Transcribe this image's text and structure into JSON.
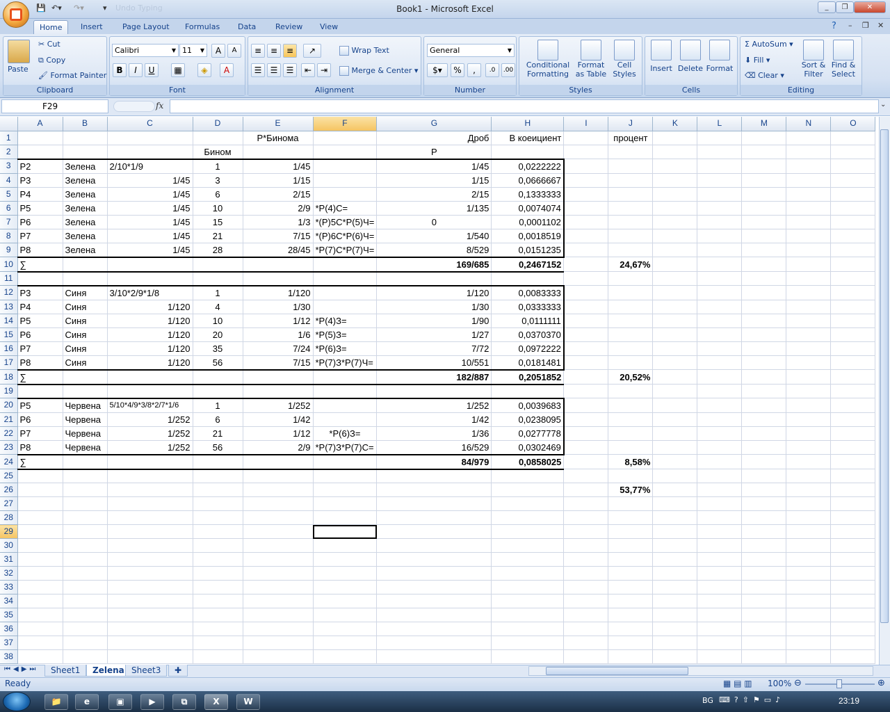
{
  "window": {
    "title": "Book1 - Microsoft Excel",
    "qat_hint": "Undo Typing"
  },
  "tabs": [
    "Home",
    "Insert",
    "Page Layout",
    "Formulas",
    "Data",
    "Review",
    "View"
  ],
  "ribbon": {
    "clipboard": {
      "paste": "Paste",
      "cut": "Cut",
      "copy": "Copy",
      "format_painter": "Format Painter",
      "label": "Clipboard"
    },
    "font": {
      "name": "Calibri",
      "size": "11",
      "bold": "B",
      "italic": "I",
      "underline": "U",
      "label": "Font"
    },
    "alignment": {
      "wrap": "Wrap Text",
      "merge": "Merge & Center",
      "label": "Alignment"
    },
    "number": {
      "format": "General",
      "percent": "%",
      "comma": ",",
      "label": "Number"
    },
    "styles": {
      "cond1": "Conditional",
      "cond2": "Formatting",
      "fat1": "Format",
      "fat2": "as Table",
      "cs1": "Cell",
      "cs2": "Styles",
      "label": "Styles"
    },
    "cells": {
      "insert": "Insert",
      "delete": "Delete",
      "format": "Format",
      "label": "Cells"
    },
    "editing": {
      "autosum": "AutoSum",
      "fill": "Fill",
      "clear": "Clear",
      "sort1": "Sort &",
      "sort2": "Filter",
      "find1": "Find &",
      "find2": "Select",
      "label": "Editing"
    }
  },
  "formula_bar": {
    "name_box": "F29",
    "fx": "fx",
    "value": ""
  },
  "columns": [
    "A",
    "B",
    "C",
    "D",
    "E",
    "F",
    "G",
    "H",
    "I",
    "J",
    "K",
    "L",
    "M",
    "N",
    "O"
  ],
  "rows": [
    {
      "n": "1",
      "A": "",
      "B": "",
      "C": "",
      "D": "",
      "E": "P*Бинома",
      "F": "",
      "G": "Дроб",
      "H": "В коеициент",
      "I": "",
      "J": "процент"
    },
    {
      "n": "2",
      "A": "",
      "B": "",
      "C": "",
      "D": "Бином",
      "E": "",
      "F": "",
      "G": "P",
      "H": "",
      "I": "",
      "J": ""
    },
    {
      "n": "3",
      "A": "P2",
      "B": "Зелена",
      "C": "2/10*1/9",
      "D": "1",
      "E": "1/45",
      "F": "",
      "G": "1/45",
      "H": "0,0222222",
      "I": "",
      "J": ""
    },
    {
      "n": "4",
      "A": "P3",
      "B": "Зелена",
      "C": "1/45",
      "D": "3",
      "E": "1/15",
      "F": "",
      "G": "1/15",
      "H": "0,0666667",
      "I": "",
      "J": ""
    },
    {
      "n": "5",
      "A": "P4",
      "B": "Зелена",
      "C": "1/45",
      "D": "6",
      "E": "2/15",
      "F": "",
      "G": "2/15",
      "H": "0,1333333",
      "I": "",
      "J": ""
    },
    {
      "n": "6",
      "A": "P5",
      "B": "Зелена",
      "C": "1/45",
      "D": "10",
      "E": "2/9",
      "F": "*P(4)C=",
      "G": "1/135",
      "H": "0,0074074",
      "I": "",
      "J": ""
    },
    {
      "n": "7",
      "A": "P6",
      "B": "Зелена",
      "C": "1/45",
      "D": "15",
      "E": "1/3",
      "F": "*(P)5C*P(5)Ч=",
      "G": "0",
      "H": "0,0001102",
      "I": "",
      "J": ""
    },
    {
      "n": "8",
      "A": "P7",
      "B": "Зелена",
      "C": "1/45",
      "D": "21",
      "E": "7/15",
      "F": "*(P)6C*P(6)Ч=",
      "G": "1/540",
      "H": "0,0018519",
      "I": "",
      "J": ""
    },
    {
      "n": "9",
      "A": "P8",
      "B": "Зелена",
      "C": "1/45",
      "D": "28",
      "E": "28/45",
      "F": "*P(7)C*P(7)Ч=",
      "G": "8/529",
      "H": "0,0151235",
      "I": "",
      "J": ""
    },
    {
      "n": "10",
      "A": "∑",
      "B": "",
      "C": "",
      "D": "",
      "E": "",
      "F": "",
      "G": "169/685",
      "H": "0,2467152",
      "I": "",
      "J": "24,67%"
    },
    {
      "n": "11",
      "A": "",
      "B": "",
      "C": "",
      "D": "",
      "E": "",
      "F": "",
      "G": "",
      "H": "",
      "I": "",
      "J": ""
    },
    {
      "n": "12",
      "A": "P3",
      "B": "Синя",
      "C": "3/10*2/9*1/8",
      "D": "1",
      "E": "1/120",
      "F": "",
      "G": "1/120",
      "H": "0,0083333",
      "I": "",
      "J": ""
    },
    {
      "n": "13",
      "A": "P4",
      "B": "Синя",
      "C": "1/120",
      "D": "4",
      "E": "1/30",
      "F": "",
      "G": "1/30",
      "H": "0,0333333",
      "I": "",
      "J": ""
    },
    {
      "n": "14",
      "A": "P5",
      "B": "Синя",
      "C": "1/120",
      "D": "10",
      "E": "1/12",
      "F": "*P(4)З=",
      "G": "1/90",
      "H": "0,0111111",
      "I": "",
      "J": ""
    },
    {
      "n": "15",
      "A": "P6",
      "B": "Синя",
      "C": "1/120",
      "D": "20",
      "E": "1/6",
      "F": "*P(5)З=",
      "G": "1/27",
      "H": "0,0370370",
      "I": "",
      "J": ""
    },
    {
      "n": "16",
      "A": "P7",
      "B": "Синя",
      "C": "1/120",
      "D": "35",
      "E": "7/24",
      "F": "*P(6)З=",
      "G": "7/72",
      "H": "0,0972222",
      "I": "",
      "J": ""
    },
    {
      "n": "17",
      "A": "P8",
      "B": "Синя",
      "C": "1/120",
      "D": "56",
      "E": "7/15",
      "F": "*P(7)З*P(7)Ч=",
      "G": "10/551",
      "H": "0,0181481",
      "I": "",
      "J": ""
    },
    {
      "n": "18",
      "A": "∑",
      "B": "",
      "C": "",
      "D": "",
      "E": "",
      "F": "",
      "G": "182/887",
      "H": "0,2051852",
      "I": "",
      "J": "20,52%"
    },
    {
      "n": "19",
      "A": "",
      "B": "",
      "C": "",
      "D": "",
      "E": "",
      "F": "",
      "G": "",
      "H": "",
      "I": "",
      "J": ""
    },
    {
      "n": "20",
      "A": "P5",
      "B": "Червена",
      "C": "5/10*4/9*3/8*2/7*1/6",
      "D": "1",
      "E": "1/252",
      "F": "",
      "G": "1/252",
      "H": "0,0039683",
      "I": "",
      "J": ""
    },
    {
      "n": "21",
      "A": "P6",
      "B": "Червена",
      "C": "1/252",
      "D": "6",
      "E": "1/42",
      "F": "",
      "G": "1/42",
      "H": "0,0238095",
      "I": "",
      "J": ""
    },
    {
      "n": "22",
      "A": "P7",
      "B": "Червена",
      "C": "1/252",
      "D": "21",
      "E": "1/12",
      "F": "*P(6)З=",
      "G": "1/36",
      "H": "0,0277778",
      "I": "",
      "J": ""
    },
    {
      "n": "23",
      "A": "P8",
      "B": "Червена",
      "C": "1/252",
      "D": "56",
      "E": "2/9",
      "F": "*P(7)З*P(7)С=",
      "G": "16/529",
      "H": "0,0302469",
      "I": "",
      "J": ""
    },
    {
      "n": "24",
      "A": "∑",
      "B": "",
      "C": "",
      "D": "",
      "E": "",
      "F": "",
      "G": "84/979",
      "H": "0,0858025",
      "I": "",
      "J": "8,58%"
    },
    {
      "n": "25",
      "A": "",
      "B": "",
      "C": "",
      "D": "",
      "E": "",
      "F": "",
      "G": "",
      "H": "",
      "I": "",
      "J": ""
    },
    {
      "n": "26",
      "A": "",
      "B": "",
      "C": "",
      "D": "",
      "E": "",
      "F": "",
      "G": "",
      "H": "",
      "I": "",
      "J": "53,77%"
    },
    {
      "n": "27"
    },
    {
      "n": "28"
    },
    {
      "n": "29"
    },
    {
      "n": "30"
    },
    {
      "n": "31"
    },
    {
      "n": "32"
    },
    {
      "n": "33"
    },
    {
      "n": "34"
    },
    {
      "n": "35"
    },
    {
      "n": "36"
    },
    {
      "n": "37"
    },
    {
      "n": "38"
    }
  ],
  "sheet_tabs": [
    "Sheet1",
    "Zelena",
    "Sheet3"
  ],
  "active_sheet": "Zelena",
  "status": {
    "text": "Ready",
    "zoom": "100%"
  },
  "taskbar": {
    "lang": "BG",
    "time": "23:19"
  }
}
